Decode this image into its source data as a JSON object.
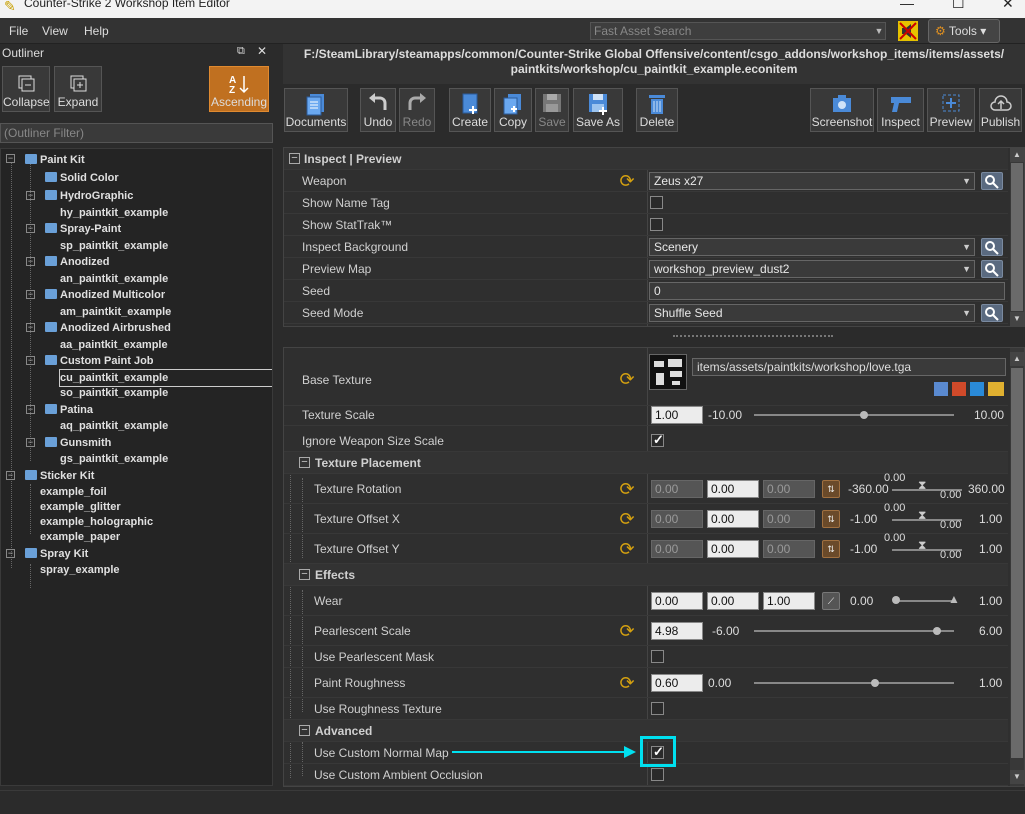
{
  "window": {
    "title": "Counter-Strike 2 Workshop Item Editor"
  },
  "menu": [
    "File",
    "View",
    "Help"
  ],
  "search": {
    "placeholder": "Fast Asset Search"
  },
  "tools": {
    "label": "Tools"
  },
  "outliner": {
    "title": "Outliner",
    "buttons": {
      "collapse": "Collapse",
      "expand": "Expand",
      "ascending": "Ascending"
    },
    "filter_placeholder": "(Outliner Filter)",
    "tree": {
      "paint_kit": "Paint Kit",
      "solid_color": "Solid Color",
      "hydrographic": "HydroGraphic",
      "hy": "hy_paintkit_example",
      "spray_paint": "Spray-Paint",
      "sp": "sp_paintkit_example",
      "anodized": "Anodized",
      "an": "an_paintkit_example",
      "anodized_multi": "Anodized Multicolor",
      "am": "am_paintkit_example",
      "anodized_air": "Anodized Airbrushed",
      "aa": "aa_paintkit_example",
      "custom": "Custom Paint Job",
      "cu": "cu_paintkit_example",
      "so": "so_paintkit_example",
      "patina": "Patina",
      "aq": "aq_paintkit_example",
      "gunsmith": "Gunsmith",
      "gs": "gs_paintkit_example",
      "sticker_kit": "Sticker Kit",
      "foil": "example_foil",
      "glitter": "example_glitter",
      "holographic": "example_holographic",
      "paper": "example_paper",
      "spray_kit": "Spray Kit",
      "spray": "spray_example"
    }
  },
  "path": {
    "line1": "F:/SteamLibrary/steamapps/common/Counter-Strike Global Offensive/content/csgo_addons/workshop_items/items/assets/",
    "line2": "paintkits/workshop/cu_paintkit_example.econitem"
  },
  "toolbar": {
    "documents": "Documents",
    "undo": "Undo",
    "redo": "Redo",
    "create": "Create",
    "copy": "Copy",
    "save": "Save",
    "save_as": "Save As",
    "delete": "Delete",
    "screenshot": "Screenshot",
    "inspect": "Inspect",
    "preview": "Preview",
    "publish": "Publish"
  },
  "inspect": {
    "section": "Inspect | Preview",
    "weapon_label": "Weapon",
    "weapon_value": "Zeus x27",
    "name_tag": "Show Name Tag",
    "stattrak": "Show StatTrak™",
    "bg_label": "Inspect Background",
    "bg_value": "Scenery",
    "map_label": "Preview Map",
    "map_value": "workshop_preview_dust2",
    "seed_label": "Seed",
    "seed_value": "0",
    "seed_mode_label": "Seed Mode",
    "seed_mode_value": "Shuffle Seed"
  },
  "props": {
    "base_texture": "Base Texture",
    "base_texture_path": "items/assets/paintkits/workshop/love.tga",
    "texture_scale": "Texture Scale",
    "texture_scale_value": "1.00",
    "texture_scale_min": "-10.00",
    "texture_scale_max": "10.00",
    "ignore_size": "Ignore Weapon Size Scale",
    "placement": "Texture Placement",
    "rotation": "Texture Rotation",
    "offset_x": "Texture Offset X",
    "offset_y": "Texture Offset Y",
    "v000": "0.00",
    "neg360": "-360.00",
    "pos360": "360.00",
    "neg1": "-1.00",
    "pos1": "1.00",
    "effects": "Effects",
    "wear": "Wear",
    "wear_max": "1.00",
    "pearl_scale": "Pearlescent Scale",
    "pearl_value": "4.98",
    "pearl_min": "-6.00",
    "pearl_max": "6.00",
    "pearl_mask": "Use Pearlescent Mask",
    "roughness": "Paint Roughness",
    "roughness_value": "0.60",
    "roughness_min": "0.00",
    "roughness_max": "1.00",
    "rough_tex": "Use Roughness Texture",
    "advanced": "Advanced",
    "normal_map": "Use Custom Normal Map",
    "ambient": "Use Custom Ambient Occlusion"
  },
  "colors": {
    "accent": "#c07020",
    "highlight": "#00e0f0"
  }
}
